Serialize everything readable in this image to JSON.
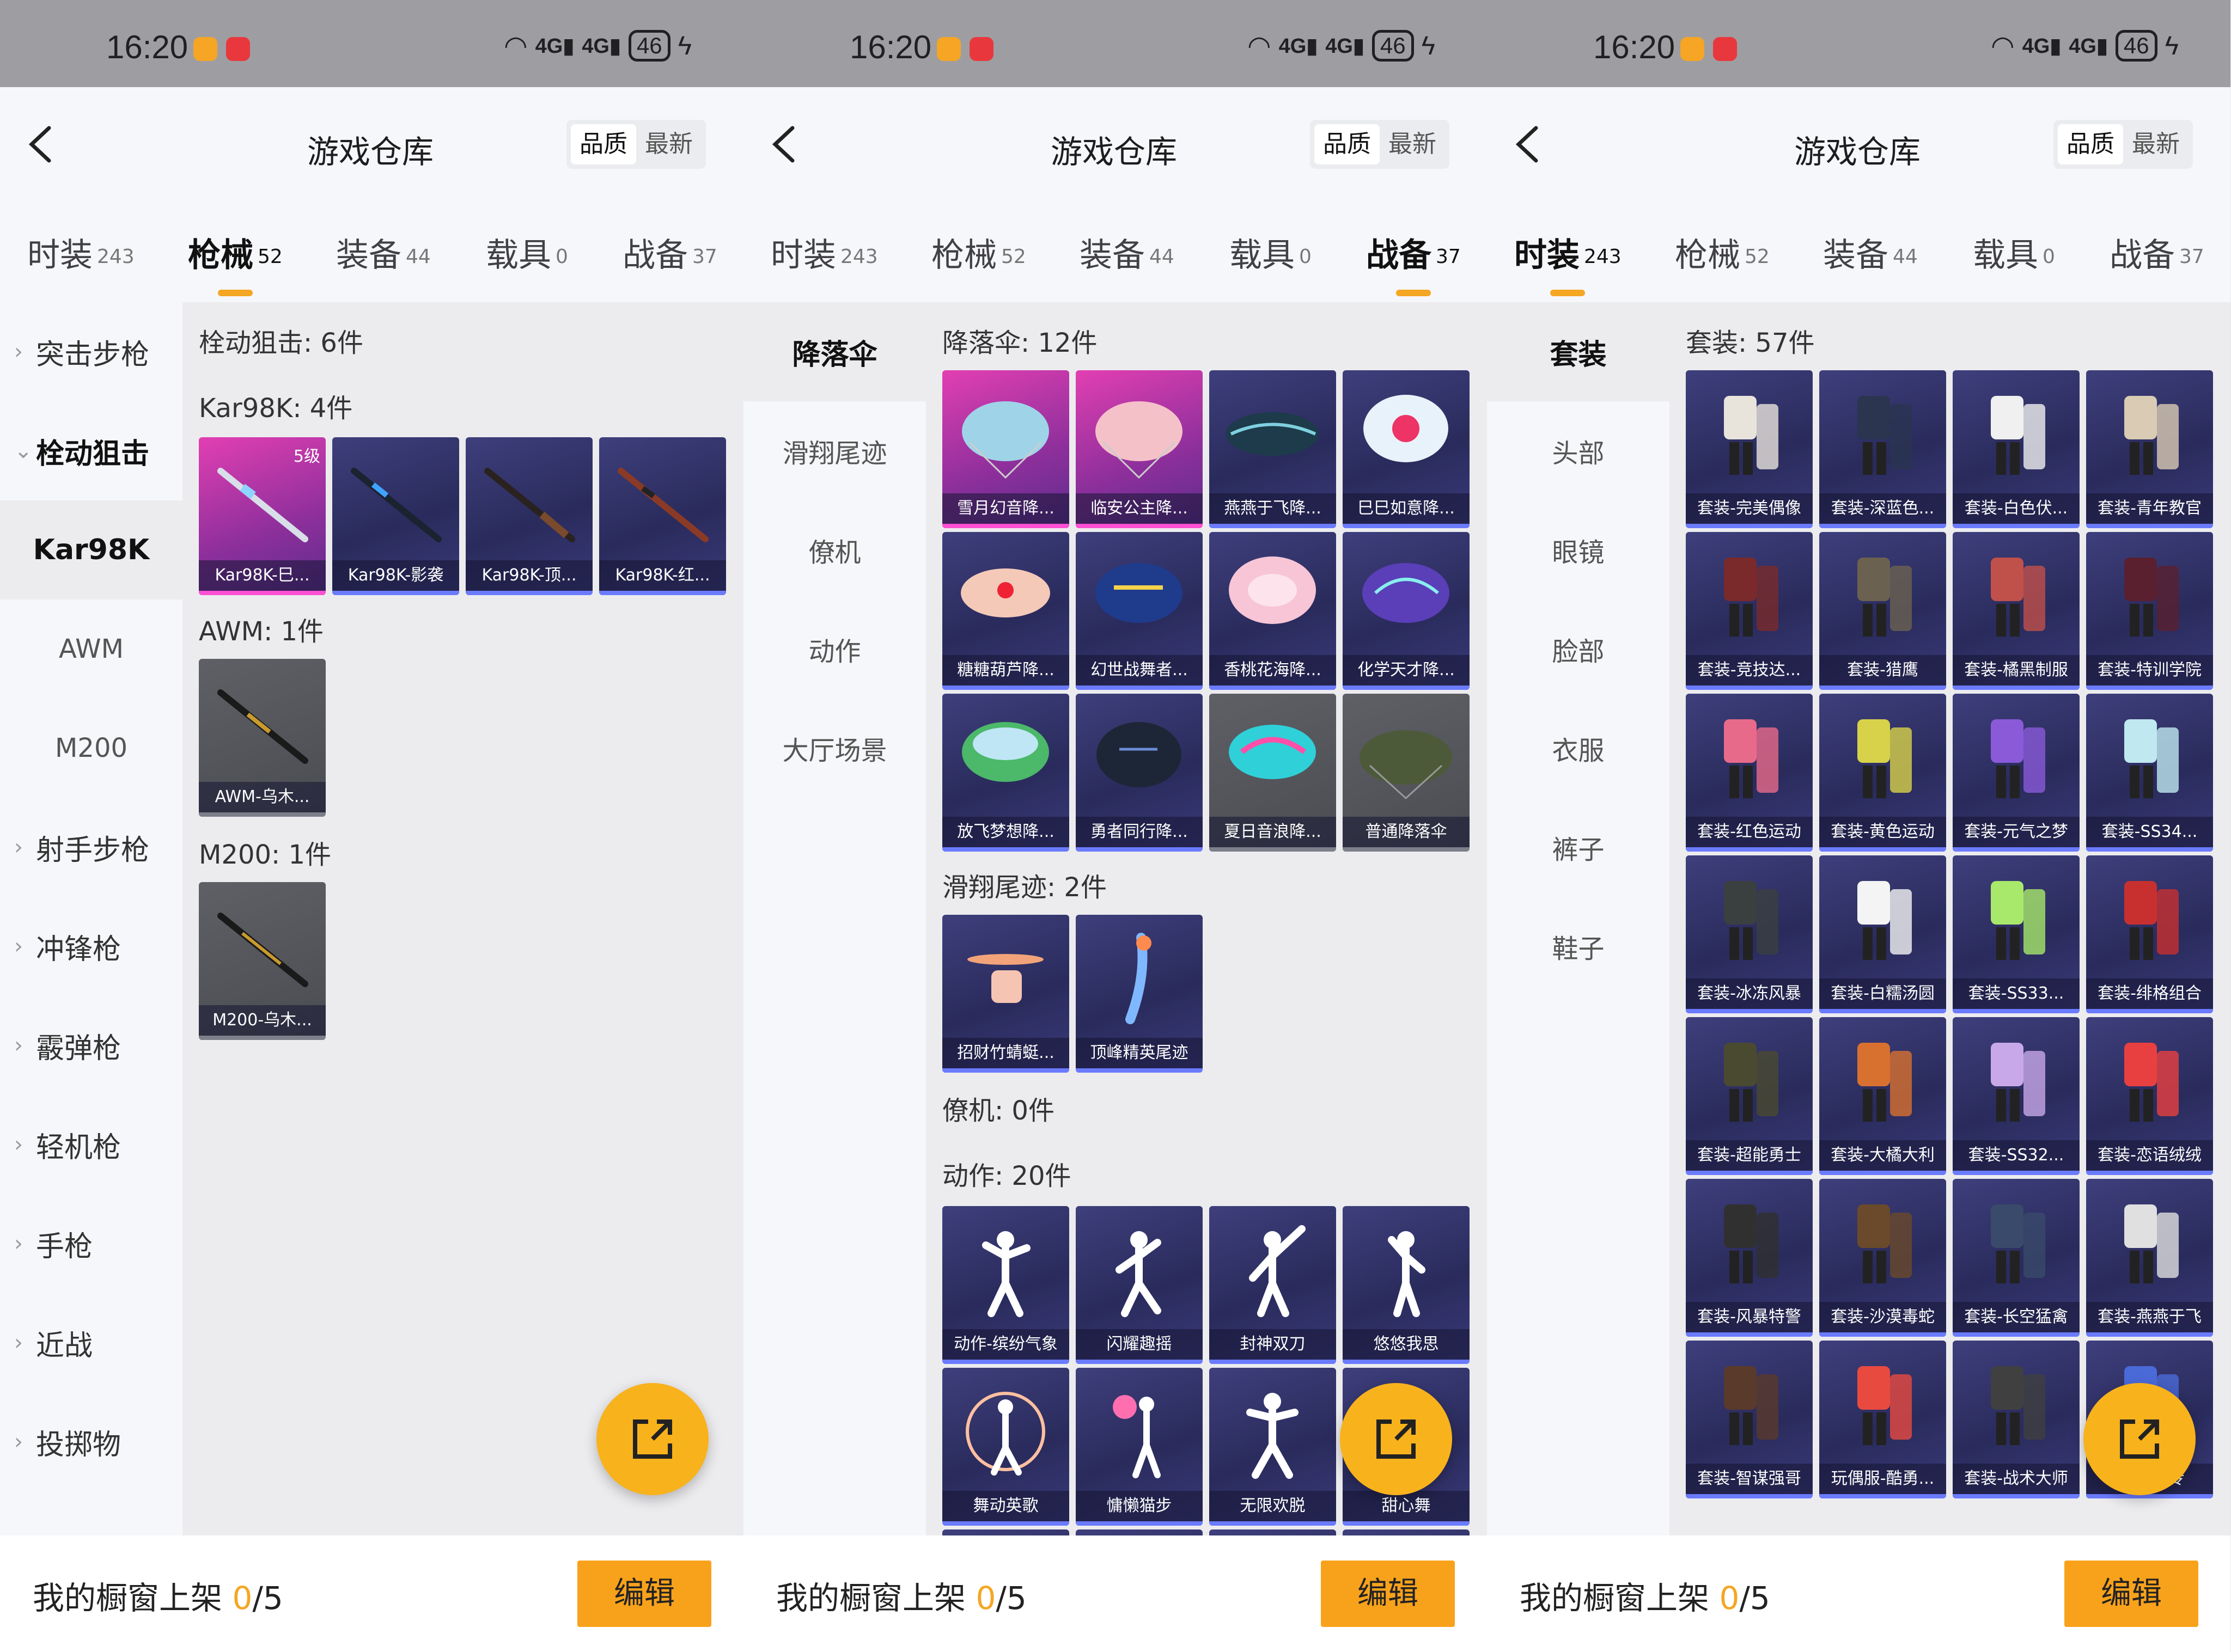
{
  "colors": {
    "accent": "#f5a623",
    "fab": "#f8b21c",
    "card_bg": "#2f3066",
    "card_pink": "#e23fb2"
  },
  "status": {
    "time": "16:20",
    "net1": "4G",
    "net2": "4G",
    "battery": "46",
    "wifi_icon": "wifi-icon",
    "bolt_icon": "charging-icon"
  },
  "screens": [
    {
      "header": {
        "back_icon": "back-chevron-icon",
        "title": "游戏仓库",
        "sort_quality": "品质",
        "sort_latest": "最新"
      },
      "tabs": [
        {
          "label": "时装",
          "count": "243"
        },
        {
          "label": "枪械",
          "count": "52"
        },
        {
          "label": "装备",
          "count": "44"
        },
        {
          "label": "载具",
          "count": "0"
        },
        {
          "label": "战备",
          "count": "37"
        }
      ],
      "side": [
        "突击步枪",
        "栓动狙击",
        "Kar98K",
        "AWM",
        "M200",
        "射手步枪",
        "冲锋枪",
        "霰弹枪",
        "轻机枪",
        "手枪",
        "近战",
        "投掷物"
      ],
      "content": {
        "title": "栓动狙击: 6件",
        "sections": [
          {
            "title": "Kar98K: 4件",
            "items": [
              "Kar98K-巳...",
              "Kar98K-影袭",
              "Kar98K-顶...",
              "Kar98K-红..."
            ],
            "level": "5级"
          },
          {
            "title": "AWM: 1件",
            "items": [
              "AWM-乌木..."
            ]
          },
          {
            "title": "M200: 1件",
            "items": [
              "M200-乌木..."
            ]
          }
        ]
      },
      "footer": {
        "text": "我的橱窗上架 ",
        "count": "0",
        "total": "/5",
        "edit": "编辑"
      }
    },
    {
      "header": {
        "back_icon": "back-chevron-icon",
        "title": "游戏仓库",
        "sort_quality": "品质",
        "sort_latest": "最新"
      },
      "tabs": [
        {
          "label": "时装",
          "count": "243"
        },
        {
          "label": "枪械",
          "count": "52"
        },
        {
          "label": "装备",
          "count": "44"
        },
        {
          "label": "载具",
          "count": "0"
        },
        {
          "label": "战备",
          "count": "37"
        }
      ],
      "side": [
        "降落伞",
        "滑翔尾迹",
        "僚机",
        "动作",
        "大厅场景"
      ],
      "content": {
        "sections": [
          {
            "title": "降落伞: 12件",
            "items": [
              "雪月幻音降...",
              "临安公主降...",
              "燕燕于飞降...",
              "巳巳如意降...",
              "糖糖葫芦降...",
              "幻世战舞者...",
              "香桃花海降...",
              "化学天才降...",
              "放飞梦想降...",
              "勇者同行降...",
              "夏日音浪降...",
              "普通降落伞"
            ]
          },
          {
            "title": "滑翔尾迹: 2件",
            "items": [
              "招财竹蜻蜓...",
              "顶峰精英尾迹"
            ]
          },
          {
            "title": "僚机: 0件",
            "items": []
          },
          {
            "title": "动作: 20件",
            "items": [
              "动作-缤纷气象",
              "闪耀趣摇",
              "封神双刀",
              "悠悠我思",
              "舞动英歌",
              "慵懒猫步",
              "无限欢脱",
              "甜心舞"
            ]
          }
        ]
      },
      "footer": {
        "text": "我的橱窗上架 ",
        "count": "0",
        "total": "/5",
        "edit": "编辑"
      }
    },
    {
      "header": {
        "back_icon": "back-chevron-icon",
        "title": "游戏仓库",
        "sort_quality": "品质",
        "sort_latest": "最新"
      },
      "tabs": [
        {
          "label": "时装",
          "count": "243"
        },
        {
          "label": "枪械",
          "count": "52"
        },
        {
          "label": "装备",
          "count": "44"
        },
        {
          "label": "载具",
          "count": "0"
        },
        {
          "label": "战备",
          "count": "37"
        }
      ],
      "side": [
        "套装",
        "头部",
        "眼镜",
        "脸部",
        "衣服",
        "裤子",
        "鞋子"
      ],
      "content": {
        "sections": [
          {
            "title": "套装: 57件",
            "items": [
              "套装-完美偶像",
              "套装-深蓝色...",
              "套装-白色伏...",
              "套装-青年教官",
              "套装-竞技达...",
              "套装-猎鹰",
              "套装-橘黑制服",
              "套装-特训学院",
              "套装-红色运动",
              "套装-黄色运动",
              "套装-元气之梦",
              "套装-SS34...",
              "套装-冰冻风暴",
              "套装-白糯汤圆",
              "套装-SS33...",
              "套装-绯格组合",
              "套装-超能勇士",
              "套装-大橘大利",
              "套装-SS32...",
              "套装-恋语绒绒",
              "套装-风暴特警",
              "套装-沙漠毒蛇",
              "套装-长空猛禽",
              "套装-燕燕于飞",
              "套装-智谋强哥",
              "玩偶服-酷勇...",
              "套装-战术大师",
              "套装-...专"
            ]
          }
        ]
      },
      "footer": {
        "text": "我的橱窗上架 ",
        "count": "0",
        "total": "/5",
        "edit": "编辑"
      }
    }
  ]
}
